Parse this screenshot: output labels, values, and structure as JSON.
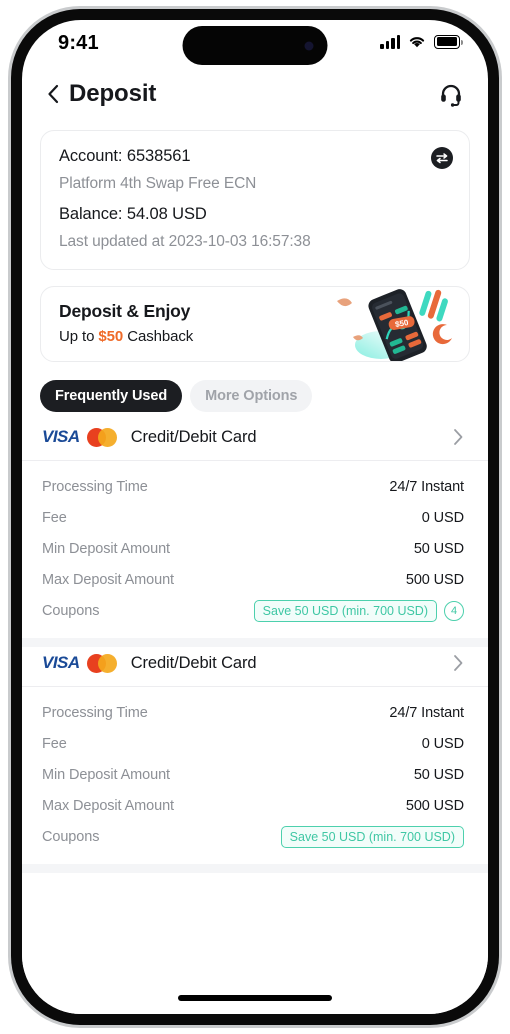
{
  "status_bar": {
    "time": "9:41",
    "signal_icon": "cellular-signal-icon",
    "wifi_icon": "wifi-icon",
    "battery_icon": "battery-icon"
  },
  "header": {
    "back_icon": "chevron-left-icon",
    "title": "Deposit",
    "support_icon": "headset-icon"
  },
  "account_card": {
    "account": "Account: 6538561",
    "platform": "Platform 4th Swap Free ECN",
    "balance": "Balance: 54.08 USD",
    "last_updated": "Last updated at 2023-10-03 16:57:38",
    "switch_icon": "swap-account-icon"
  },
  "promo": {
    "title": "Deposit & Enjoy",
    "sub_prefix": "Up to ",
    "amount": "$50",
    "sub_suffix": " Cashback",
    "amount_color": "#ef6a28",
    "art_icon": "trading-phone-illustration"
  },
  "tabs": [
    {
      "label": "Frequently Used",
      "active": true
    },
    {
      "label": "More Options",
      "active": false
    }
  ],
  "methods": [
    {
      "name": "Credit/Debit Card",
      "visa_logo": "VISA",
      "mastercard_icon": "mastercard-icon",
      "arrow_icon": "chevron-right-icon",
      "rows": [
        {
          "label": "Processing Time",
          "value": "24/7 Instant"
        },
        {
          "label": "Fee",
          "value": "0 USD"
        },
        {
          "label": "Min Deposit Amount",
          "value": "50 USD"
        },
        {
          "label": "Max Deposit Amount",
          "value": "500 USD"
        }
      ],
      "coupons_label": "Coupons",
      "coupon_chip": "Save 50 USD (min. 700 USD)",
      "coupon_count": "4",
      "has_coupon_count": true
    },
    {
      "name": "Credit/Debit Card",
      "visa_logo": "VISA",
      "mastercard_icon": "mastercard-icon",
      "arrow_icon": "chevron-right-icon",
      "rows": [
        {
          "label": "Processing Time",
          "value": "24/7 Instant"
        },
        {
          "label": "Fee",
          "value": "0 USD"
        },
        {
          "label": "Min Deposit Amount",
          "value": "50 USD"
        },
        {
          "label": "Max Deposit Amount",
          "value": "500 USD"
        }
      ],
      "coupons_label": "Coupons",
      "coupon_chip": "Save 50 USD (min. 700 USD)",
      "coupon_count": "",
      "has_coupon_count": false
    }
  ],
  "colors": {
    "accent_dark": "#1c1e22",
    "coupon_teal": "#3fc7a4",
    "promo_orange": "#ef6a28",
    "visa_blue": "#1a4a97"
  }
}
